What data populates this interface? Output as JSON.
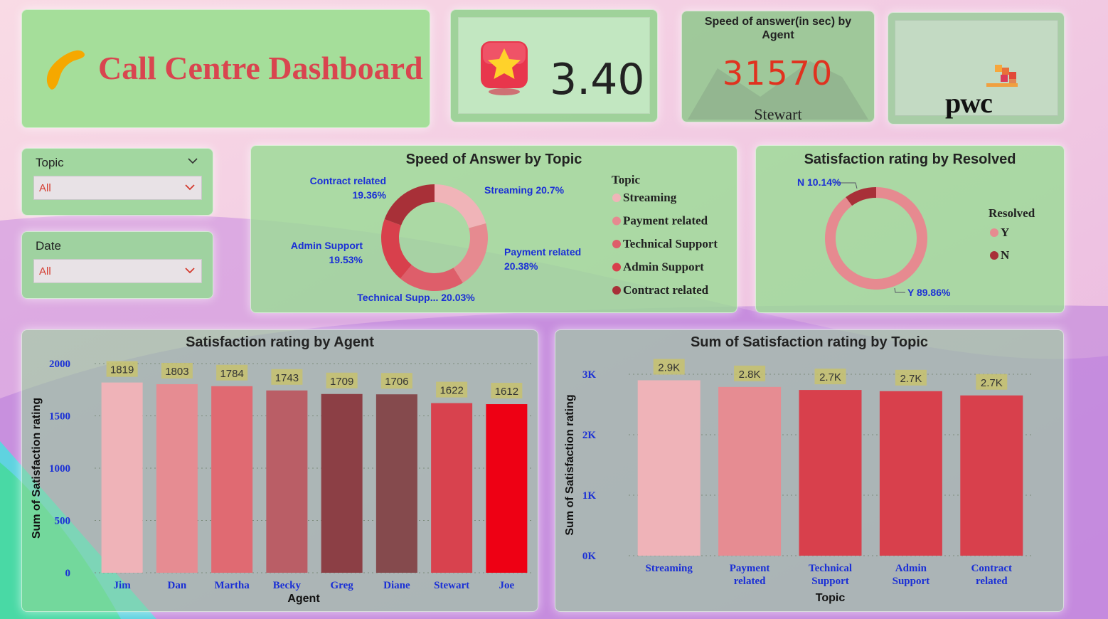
{
  "header": {
    "title": "Call Centre Dashboard"
  },
  "kpi": {
    "rating_value": "3.40"
  },
  "speed_kpi": {
    "title_line1": "Speed of answer(in sec) by",
    "title_line2": "Agent",
    "value": "31570",
    "agent": "Stewart"
  },
  "logo": {
    "text": "pwc"
  },
  "filters": {
    "topic": {
      "label": "Topic",
      "value": "All"
    },
    "date": {
      "label": "Date",
      "value": "All"
    }
  },
  "colors": {
    "streaming": "#f0b4b8",
    "payment": "#e68a90",
    "technical": "#de5e6a",
    "admin": "#d8404c",
    "contract": "#a83038",
    "label_blue": "#1a2fd6"
  },
  "chart_data": [
    {
      "type": "pie",
      "title": "Speed of Answer by Topic",
      "legend_title": "Topic",
      "legend_position": "right",
      "categories": [
        "Streaming",
        "Payment related",
        "Technical Support",
        "Admin Support",
        "Contract related"
      ],
      "values": [
        20.7,
        20.38,
        20.03,
        19.53,
        19.36
      ],
      "data_labels": [
        "Streaming 20.7%",
        "Payment related 20.38%",
        "Technical Supp... 20.03%",
        "Admin Support 19.53%",
        "Contract related 19.36%"
      ]
    },
    {
      "type": "pie",
      "title": "Satisfaction rating by Resolved",
      "legend_title": "Resolved",
      "legend_position": "right",
      "categories": [
        "Y",
        "N"
      ],
      "values": [
        89.86,
        10.14
      ],
      "data_labels": [
        "Y 89.86%",
        "N 10.14%"
      ]
    },
    {
      "type": "bar",
      "title": "Satisfaction rating by Agent",
      "xlabel": "Agent",
      "ylabel": "Sum of Satisfaction rating",
      "categories": [
        "Jim",
        "Dan",
        "Martha",
        "Becky",
        "Greg",
        "Diane",
        "Stewart",
        "Joe"
      ],
      "values": [
        1819,
        1803,
        1784,
        1743,
        1709,
        1706,
        1622,
        1612
      ],
      "ylim": [
        0,
        2000
      ],
      "yticks": [
        "0",
        "500",
        "1000",
        "1500",
        "2000"
      ],
      "grid": true
    },
    {
      "type": "bar",
      "title": "Sum of Satisfaction rating by Topic",
      "xlabel": "Topic",
      "ylabel": "Sum of Satisfaction rating",
      "categories": [
        "Streaming",
        "Payment related",
        "Technical Support",
        "Admin Support",
        "Contract related"
      ],
      "values": [
        2900,
        2790,
        2740,
        2720,
        2650
      ],
      "data_labels": [
        "2.9K",
        "2.8K",
        "2.7K",
        "2.7K",
        "2.7K"
      ],
      "ylim": [
        0,
        3000
      ],
      "yticks": [
        "0K",
        "1K",
        "2K",
        "3K"
      ],
      "grid": true
    }
  ]
}
